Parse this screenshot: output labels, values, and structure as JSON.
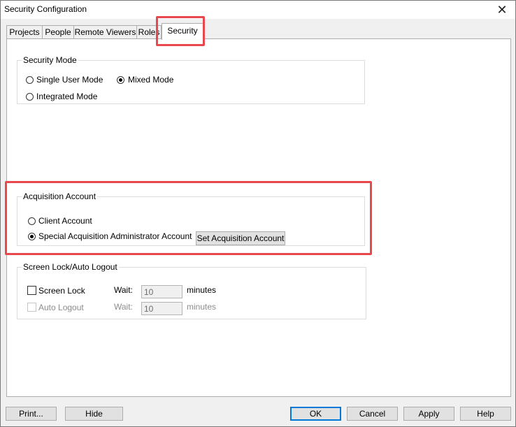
{
  "window": {
    "title": "Security Configuration"
  },
  "tabs": [
    {
      "label": "Projects"
    },
    {
      "label": "People"
    },
    {
      "label": "Remote Viewers"
    },
    {
      "label": "Roles"
    },
    {
      "label": "Security",
      "selected": true
    }
  ],
  "security_mode": {
    "legend": "Security Mode",
    "options": [
      {
        "label": "Single User Mode",
        "checked": false
      },
      {
        "label": "Mixed Mode",
        "checked": true
      },
      {
        "label": "Integrated Mode",
        "checked": false
      }
    ]
  },
  "acquisition": {
    "legend": "Acquisition Account",
    "options": [
      {
        "label": "Client Account",
        "checked": false
      },
      {
        "label": "Special Acquisition Administrator Account",
        "checked": true
      }
    ],
    "set_button": "Set Acquisition Account"
  },
  "screen_lock": {
    "legend": "Screen Lock/Auto Logout",
    "screen_lock": {
      "label": "Screen Lock",
      "checked": false,
      "wait_label": "Wait:",
      "wait_value": "10",
      "unit": "minutes"
    },
    "auto_logout": {
      "label": "Auto Logout",
      "checked": false,
      "disabled": true,
      "wait_label": "Wait:",
      "wait_value": "10",
      "unit": "minutes"
    }
  },
  "buttons": {
    "print": "Print...",
    "hide": "Hide",
    "ok": "OK",
    "cancel": "Cancel",
    "apply": "Apply",
    "help": "Help"
  },
  "colors": {
    "highlight": "#e8474d",
    "default_button_border": "#0078d7"
  }
}
